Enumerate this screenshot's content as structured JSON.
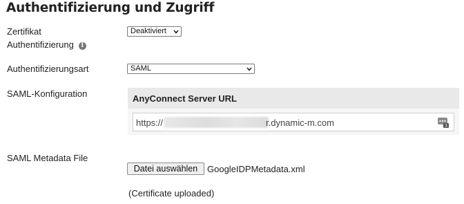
{
  "title": "Authentifizierung und Zugriff",
  "cert_auth": {
    "label_line1": "Zertifikat",
    "label_line2": "Authentifizierung",
    "select_value": "Deaktiviert"
  },
  "auth_type": {
    "label": "Authentifizierungsart",
    "select_value": "SAML"
  },
  "saml_config": {
    "label": "SAML-Konfiguration",
    "panel_title": "AnyConnect Server URL",
    "url_prefix": "https://",
    "url_suffix": "r.dynamic-m.com"
  },
  "metadata": {
    "label": "SAML Metadata File",
    "button_label": "Datei auswählen",
    "file_name": "GoogleIDPMetadata.xml",
    "status": "(Certificate uploaded)"
  },
  "icons": [
    "info-icon",
    "chevron-down-icon",
    "key-icon"
  ]
}
